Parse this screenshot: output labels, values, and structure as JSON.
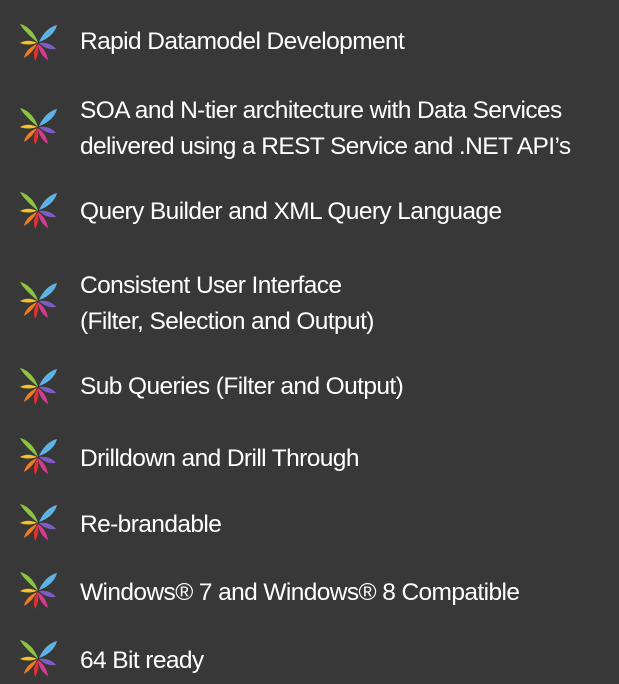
{
  "background_color": "#383838",
  "text_color": "#ffffff",
  "logo": {
    "icon": "pinwheel-logo-icon",
    "petal_colors": [
      "#8bc43f",
      "#5fb3e4",
      "#7c5cc4",
      "#d63a8f",
      "#e0312f",
      "#f07d22",
      "#f6c02b"
    ]
  },
  "features": [
    {
      "lines": [
        "Rapid Datamodel Development"
      ]
    },
    {
      "lines": [
        "SOA and N-tier architecture with Data Services",
        "delivered using a REST Service and .NET API’s"
      ]
    },
    {
      "lines": [
        "Query Builder and XML Query Language"
      ]
    },
    {
      "lines": [
        "Consistent User Interface",
        "(Filter, Selection and Output)"
      ]
    },
    {
      "lines": [
        "Sub Queries (Filter and Output)"
      ]
    },
    {
      "lines": [
        "Drilldown and Drill Through"
      ]
    },
    {
      "lines": [
        "Re-brandable"
      ]
    },
    {
      "lines": [
        "Windows® 7 and Windows® 8 Compatible"
      ]
    },
    {
      "lines": [
        "64 Bit ready"
      ]
    }
  ]
}
